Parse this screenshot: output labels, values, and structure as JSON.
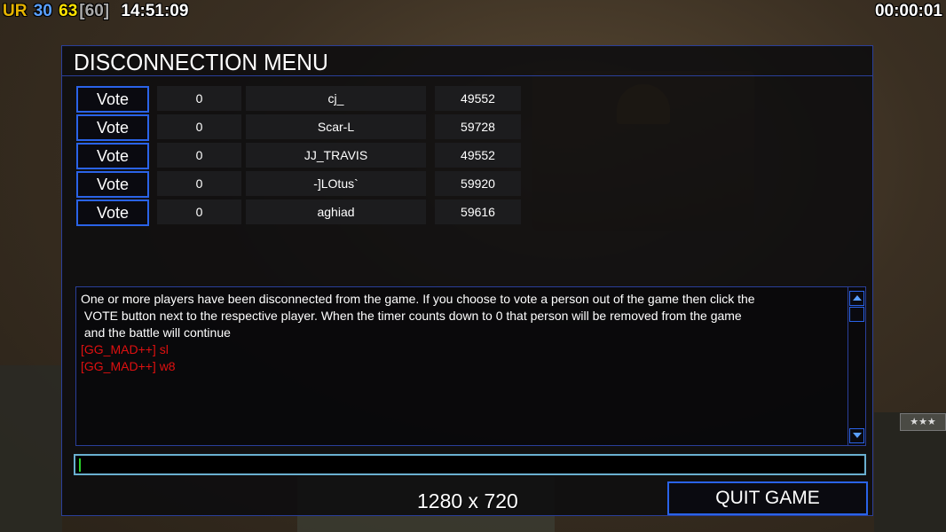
{
  "hud": {
    "ur": "UR",
    "fps": "30",
    "game_fps": "63",
    "fps_limit": "[60]",
    "clock": "14:51:09",
    "game_timer": "00:00:01"
  },
  "menu": {
    "title": "DISCONNECTION MENU",
    "vote_label": "Vote",
    "players": [
      {
        "votes": "0",
        "name": "cj_",
        "ping": "49552"
      },
      {
        "votes": "0",
        "name": "Scar-L",
        "ping": "59728"
      },
      {
        "votes": "0",
        "name": "JJ_TRAVIS",
        "ping": "49552"
      },
      {
        "votes": "0",
        "name": "-]LOtus`",
        "ping": "59920"
      },
      {
        "votes": "0",
        "name": "aghiad",
        "ping": "59616"
      }
    ],
    "message_lines": [
      "One or more players have been disconnected from the game. If you choose to vote a person out of the game then click the",
      " VOTE button next to the respective player. When the timer counts down to 0 that person will be removed from the game",
      " and the battle will continue"
    ],
    "chat_lines": [
      "[GG_MAD++] sl",
      "[GG_MAD++] w8"
    ],
    "chat_input_value": "",
    "quit_label": "QUIT GAME"
  },
  "overlay": {
    "resolution": "1280 x 720",
    "rank_stars": "★★★"
  },
  "colors": {
    "panel_border": "#2a3f9a",
    "button_border": "#2a63e8",
    "chat_red": "#e01010",
    "hud_ur": "#e6b400",
    "hud_fps": "#5aa0ff",
    "hud_game_fps": "#ffe300"
  }
}
